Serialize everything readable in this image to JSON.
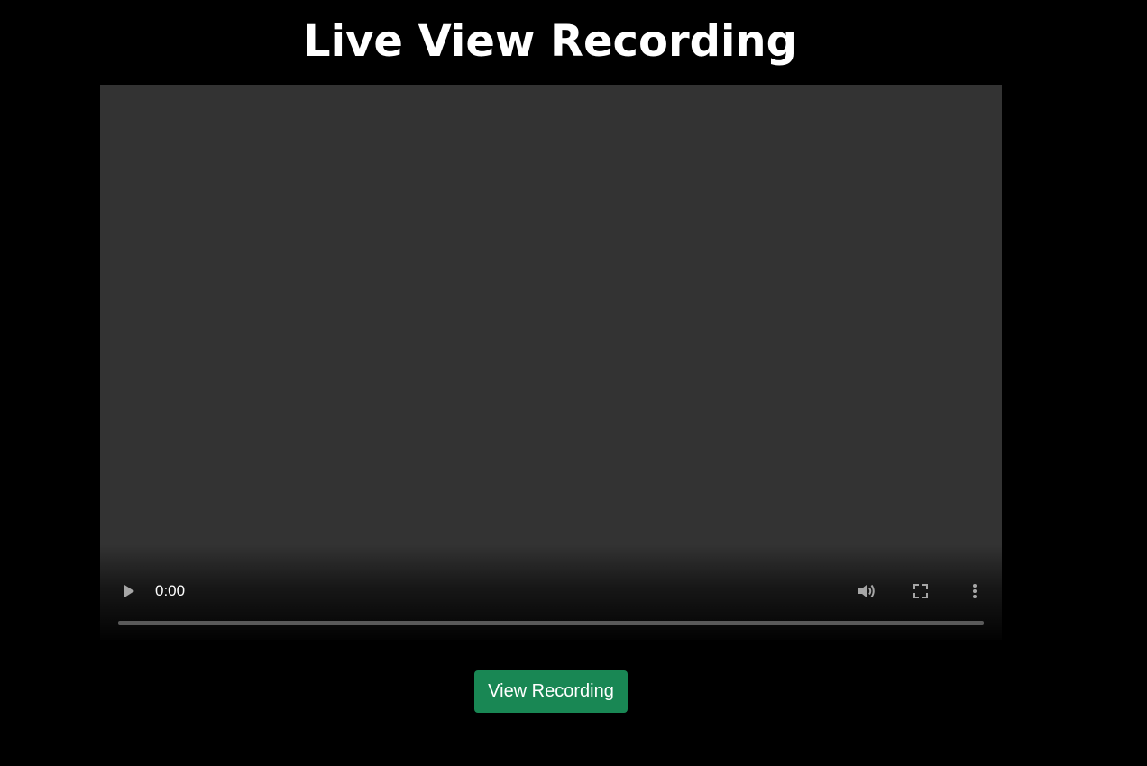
{
  "page": {
    "title": "Live View Recording"
  },
  "player": {
    "current_time": "0:00",
    "progress_fraction": 0,
    "icons": {
      "play": "play-icon",
      "volume": "volume-icon",
      "fullscreen": "fullscreen-icon",
      "more": "more-vert-icon"
    }
  },
  "actions": {
    "view_recording_label": "View Recording"
  },
  "colors": {
    "background": "#000000",
    "video_area": "#333333",
    "button": "#198754",
    "text": "#ffffff"
  }
}
